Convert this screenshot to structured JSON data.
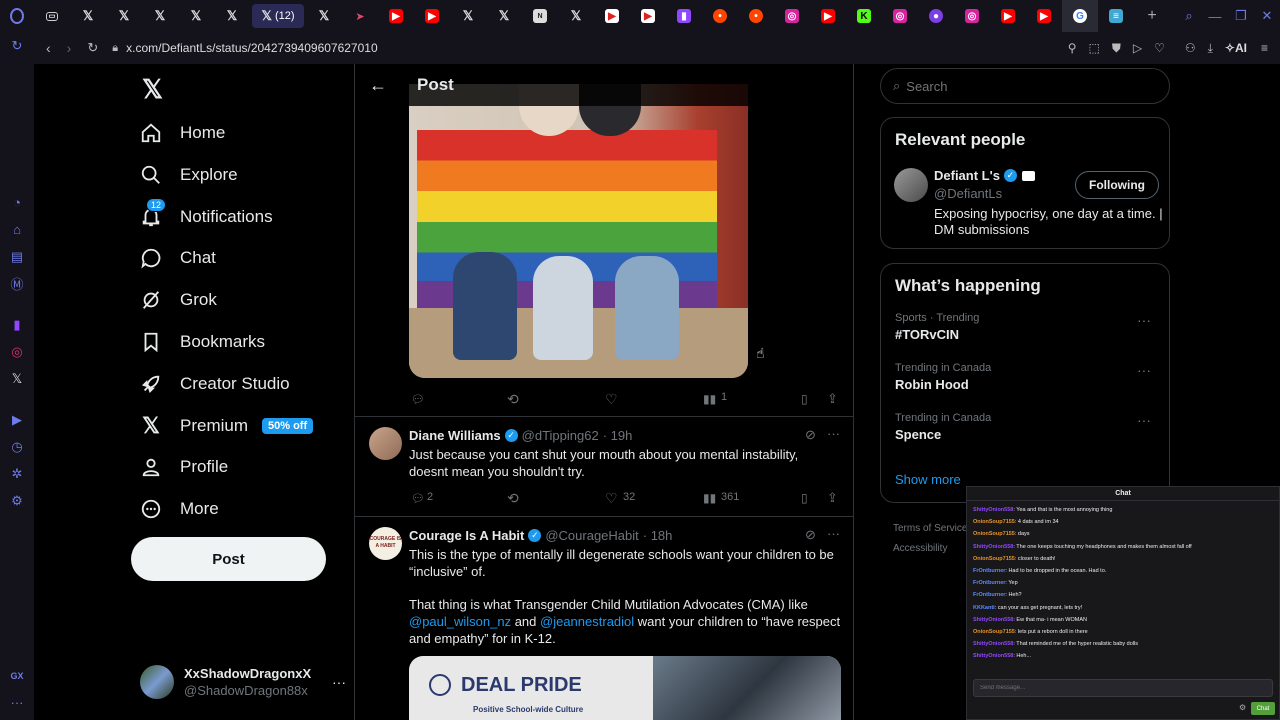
{
  "browser": {
    "active_tab_count": "(12)",
    "url": "x.com/DefiantLs/status/2042739409607627010",
    "ai_label": "AI"
  },
  "nav": {
    "items": [
      {
        "label": "Home",
        "icon": "home-icon"
      },
      {
        "label": "Explore",
        "icon": "search-icon"
      },
      {
        "label": "Notifications",
        "icon": "bell-icon",
        "badge": "12"
      },
      {
        "label": "Chat",
        "icon": "chat-icon"
      },
      {
        "label": "Grok",
        "icon": "grok-icon"
      },
      {
        "label": "Bookmarks",
        "icon": "bookmark-icon"
      },
      {
        "label": "Creator Studio",
        "icon": "rocket-icon"
      },
      {
        "label": "Premium",
        "icon": "x-icon",
        "badge": "50% off"
      },
      {
        "label": "Profile",
        "icon": "person-icon"
      },
      {
        "label": "More",
        "icon": "more-circle-icon"
      }
    ],
    "post_button": "Post",
    "account": {
      "name": "XxShadowDragonxX",
      "handle": "@ShadowDragon88x"
    }
  },
  "header": {
    "title": "Post"
  },
  "main_post": {
    "views": "1"
  },
  "replies": [
    {
      "name": "Diane Williams",
      "handle": "@dTipping62",
      "time": "· 19h",
      "text": "Just because you cant shut your mouth about you mental instability, doesnt mean you shouldn't try.",
      "replies": "2",
      "likes": "32",
      "views": "361"
    },
    {
      "name": "Courage Is A Habit",
      "handle": "@CourageHabit",
      "time": "· 18h",
      "avatar_text": "COURAGE IS A HABIT",
      "text1": "This is the type of mentally ill degenerate schools want your children to be “inclusive” of.",
      "text2a": "That thing is what Transgender Child Mutilation Advocates (CMA) like ",
      "mention1": "@paul_wilson_nz",
      "text2b": " and ",
      "mention2": "@jeannestradiol",
      "text2c": " want your children to “have respect and empathy” for in K-12.",
      "image_title": "DEAL PRIDE",
      "image_subtitle": "Positive School-wide Culture"
    }
  ],
  "search": {
    "placeholder": "Search"
  },
  "relevant": {
    "title": "Relevant people",
    "name": "Defiant L's",
    "handle": "@DefiantLs",
    "follow_label": "Following",
    "bio": "Exposing hypocrisy, one day at a time. | DM submissions"
  },
  "happening": {
    "title": "What’s happening",
    "trends": [
      {
        "meta": "Sports · Trending",
        "name": "#TORvCIN"
      },
      {
        "meta": "Trending in Canada",
        "name": "Robin Hood"
      },
      {
        "meta": "Trending in Canada",
        "name": "Spence"
      }
    ],
    "show_more": "Show more"
  },
  "footer": {
    "terms": "Terms of Service",
    "accessibility": "Accessibility"
  },
  "chat": {
    "title": "Chat",
    "messages": [
      {
        "user": "ShittyOnion558",
        "text": ": Yea and that is the most annoying thing"
      },
      {
        "user": "OnionSoup7155",
        "text": ": 4 dats and im 34"
      },
      {
        "user": "OnionSoup7155",
        "text": ": days"
      },
      {
        "user": "ShittyOnion558",
        "text": ": The one keeps touching my headphones and makes them almost fall off"
      },
      {
        "user": "OnionSoup7155",
        "text": ": closer to death!"
      },
      {
        "user": "FrOntburner",
        "text": ": Had to be dropped in the ocean. Had to."
      },
      {
        "user": "FrOntburner",
        "text": ": Yep"
      },
      {
        "user": "FrOntburner",
        "text": ": Heh?"
      },
      {
        "user": "KKKanti",
        "text": ": can your ass get pregnant, lets try!"
      },
      {
        "user": "ShittyOnion558",
        "text": ": Ew that ma- i mean WOMAN"
      },
      {
        "user": "OnionSoup7155",
        "text": ": lets put a reborn doll in there"
      },
      {
        "user": "ShittyOnion558",
        "text": ": That reminded me of the hyper realistic baby dolls"
      },
      {
        "user": "ShittyOnion558",
        "text": ": Heh..."
      }
    ],
    "input_placeholder": "Send message...",
    "send_label": "Chat"
  },
  "colors": {
    "accent": "#1d9bf0",
    "gx": "#6e7be8",
    "twitch": "#9147ff"
  }
}
